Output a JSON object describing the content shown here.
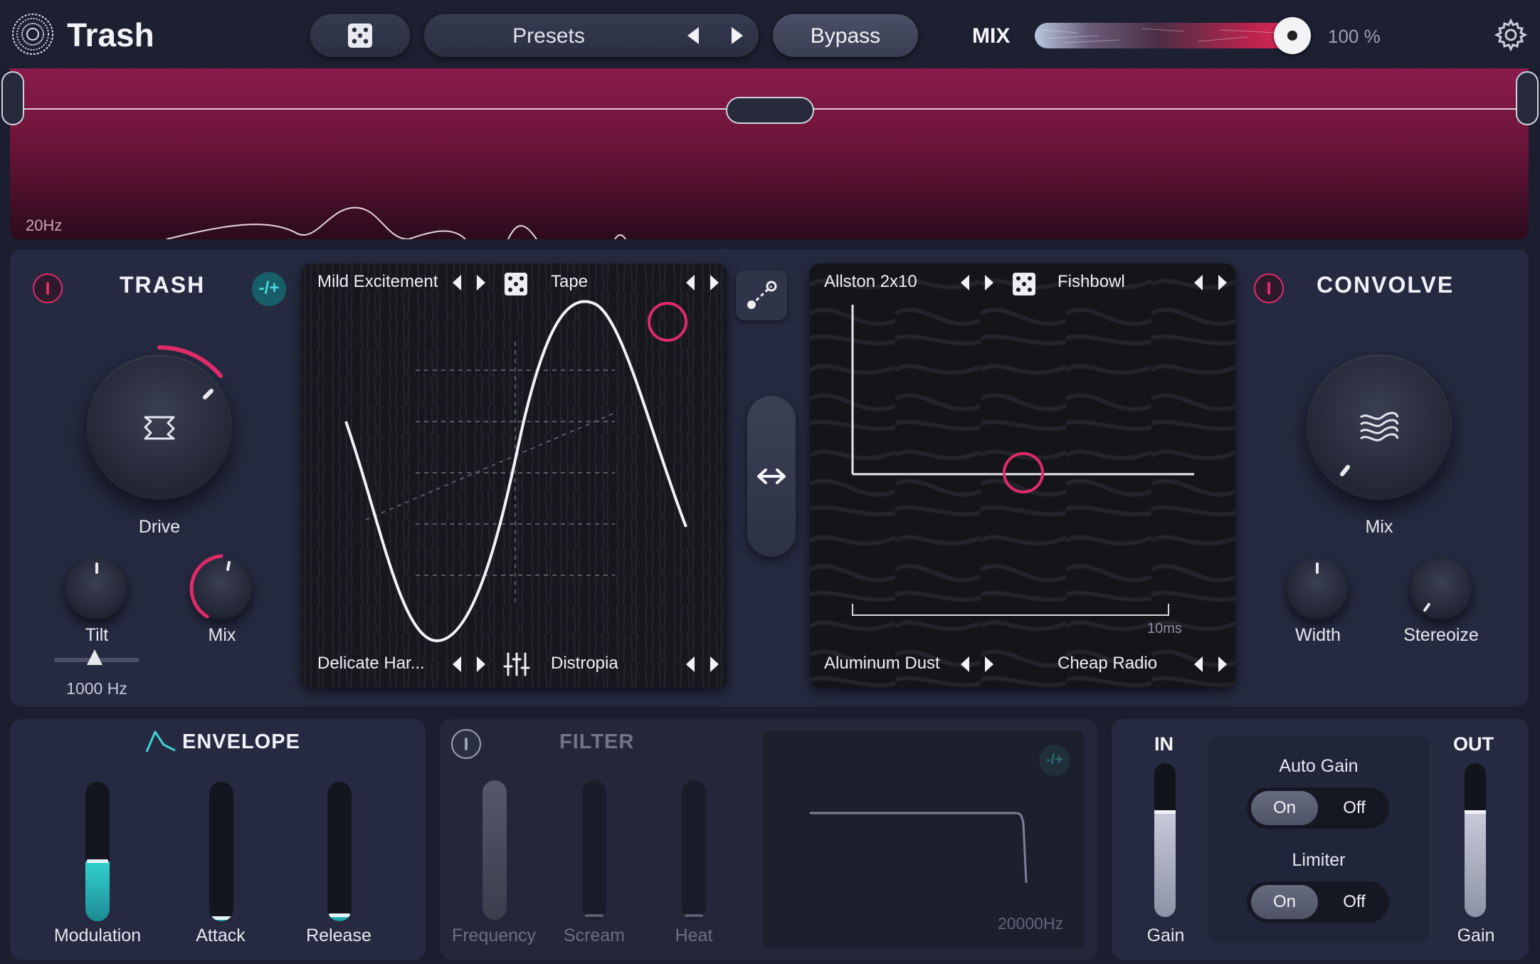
{
  "app": {
    "title": "Trash"
  },
  "topbar": {
    "presets_label": "Presets",
    "bypass_label": "Bypass",
    "mix_label": "MIX",
    "mix_value": "100 %",
    "mix_level": 1.0
  },
  "spectrum": {
    "low_label": "20Hz"
  },
  "trash": {
    "title": "TRASH",
    "pm_label": "-/+",
    "drive_label": "Drive",
    "tilt_label": "Tilt",
    "mix_label": "Mix",
    "tilt_freq": "1000 Hz",
    "pad": {
      "top_left": "Mild Excitement",
      "top_right": "Tape",
      "bottom_left": "Delicate Har...",
      "bottom_right": "Distropia"
    }
  },
  "convolve": {
    "title": "CONVOLVE",
    "mix_label": "Mix",
    "width_label": "Width",
    "stereoize_label": "Stereoize",
    "pad": {
      "top_left": "Allston 2x10",
      "top_right": "Fishbowl",
      "bottom_left": "Aluminum Dust",
      "bottom_right": "Cheap Radio",
      "time_label": "10ms"
    }
  },
  "envelope": {
    "title": "ENVELOPE",
    "modulation_label": "Modulation",
    "attack_label": "Attack",
    "release_label": "Release",
    "modulation_level": 0.43,
    "attack_level": 0.02,
    "release_level": 0.04
  },
  "filter": {
    "title": "FILTER",
    "pm_label": "-/+",
    "frequency_label": "Frequency",
    "scream_label": "Scream",
    "heat_label": "Heat",
    "freq_readout": "20000Hz"
  },
  "io": {
    "in_title": "IN",
    "out_title": "OUT",
    "in_gain_label": "Gain",
    "out_gain_label": "Gain",
    "in_level": 0.68,
    "out_level": 0.68,
    "auto_gain_label": "Auto Gain",
    "limiter_label": "Limiter",
    "on_label": "On",
    "off_label": "Off"
  },
  "colors": {
    "accent_pink": "#e02b6a",
    "accent_teal": "#32d2cf",
    "panel": "#252a40",
    "background": "#1b1e2e"
  },
  "icons": [
    "app-logo-icon",
    "dice-icon",
    "gear-icon",
    "drive-icon",
    "wave-icon",
    "link-icon",
    "swap-arrows-icon",
    "eq-sliders-icon",
    "envelope-icon",
    "power-icon"
  ]
}
